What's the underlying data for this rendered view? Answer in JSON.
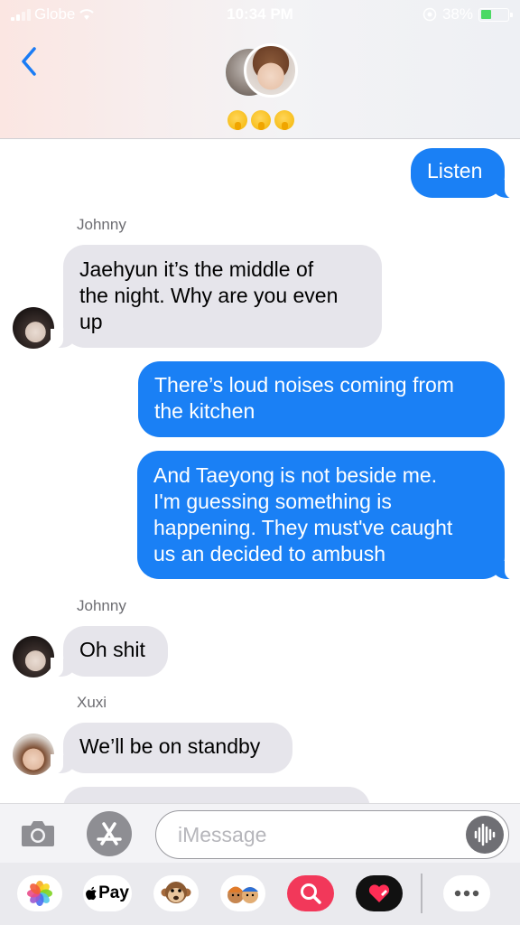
{
  "status_bar": {
    "carrier": "Globe",
    "time": "10:34 PM",
    "battery": "38%"
  },
  "header": {
    "back_icon": "chevron-left-icon",
    "emojis": [
      "shushing-face",
      "shushing-face",
      "shushing-face"
    ]
  },
  "messages": [
    {
      "direction": "outgoing",
      "text": "Listen"
    },
    {
      "direction": "incoming",
      "sender": "Johnny",
      "lines": [
        "Jaehyun it’s the middle of",
        "the night. Why are you even",
        "up"
      ]
    },
    {
      "direction": "outgoing",
      "lines": [
        "There’s loud noises coming from",
        "the kitchen"
      ]
    },
    {
      "direction": "outgoing",
      "lines": [
        "And Taeyong is not beside me.",
        "I'm guessing something is",
        "happening. They must've caught",
        "us an decided to ambush"
      ]
    },
    {
      "direction": "incoming",
      "sender": "Johnny",
      "text": "Oh shit"
    },
    {
      "direction": "incoming",
      "sender": "Xuxi",
      "text": "We’ll be on standby"
    }
  ],
  "composer": {
    "placeholder": "iMessage"
  },
  "app_drawer": {
    "apple_pay_label": "Pay",
    "apps": [
      "photos-icon",
      "apple-pay-icon",
      "monkey-animoji-icon",
      "memoji-icon",
      "search-images-icon",
      "digital-touch-icon",
      "more-icon"
    ]
  },
  "colors": {
    "outgoing_bubble": "#1a80f5",
    "incoming_bubble": "#e6e5eb",
    "battery": "#4cd964"
  }
}
